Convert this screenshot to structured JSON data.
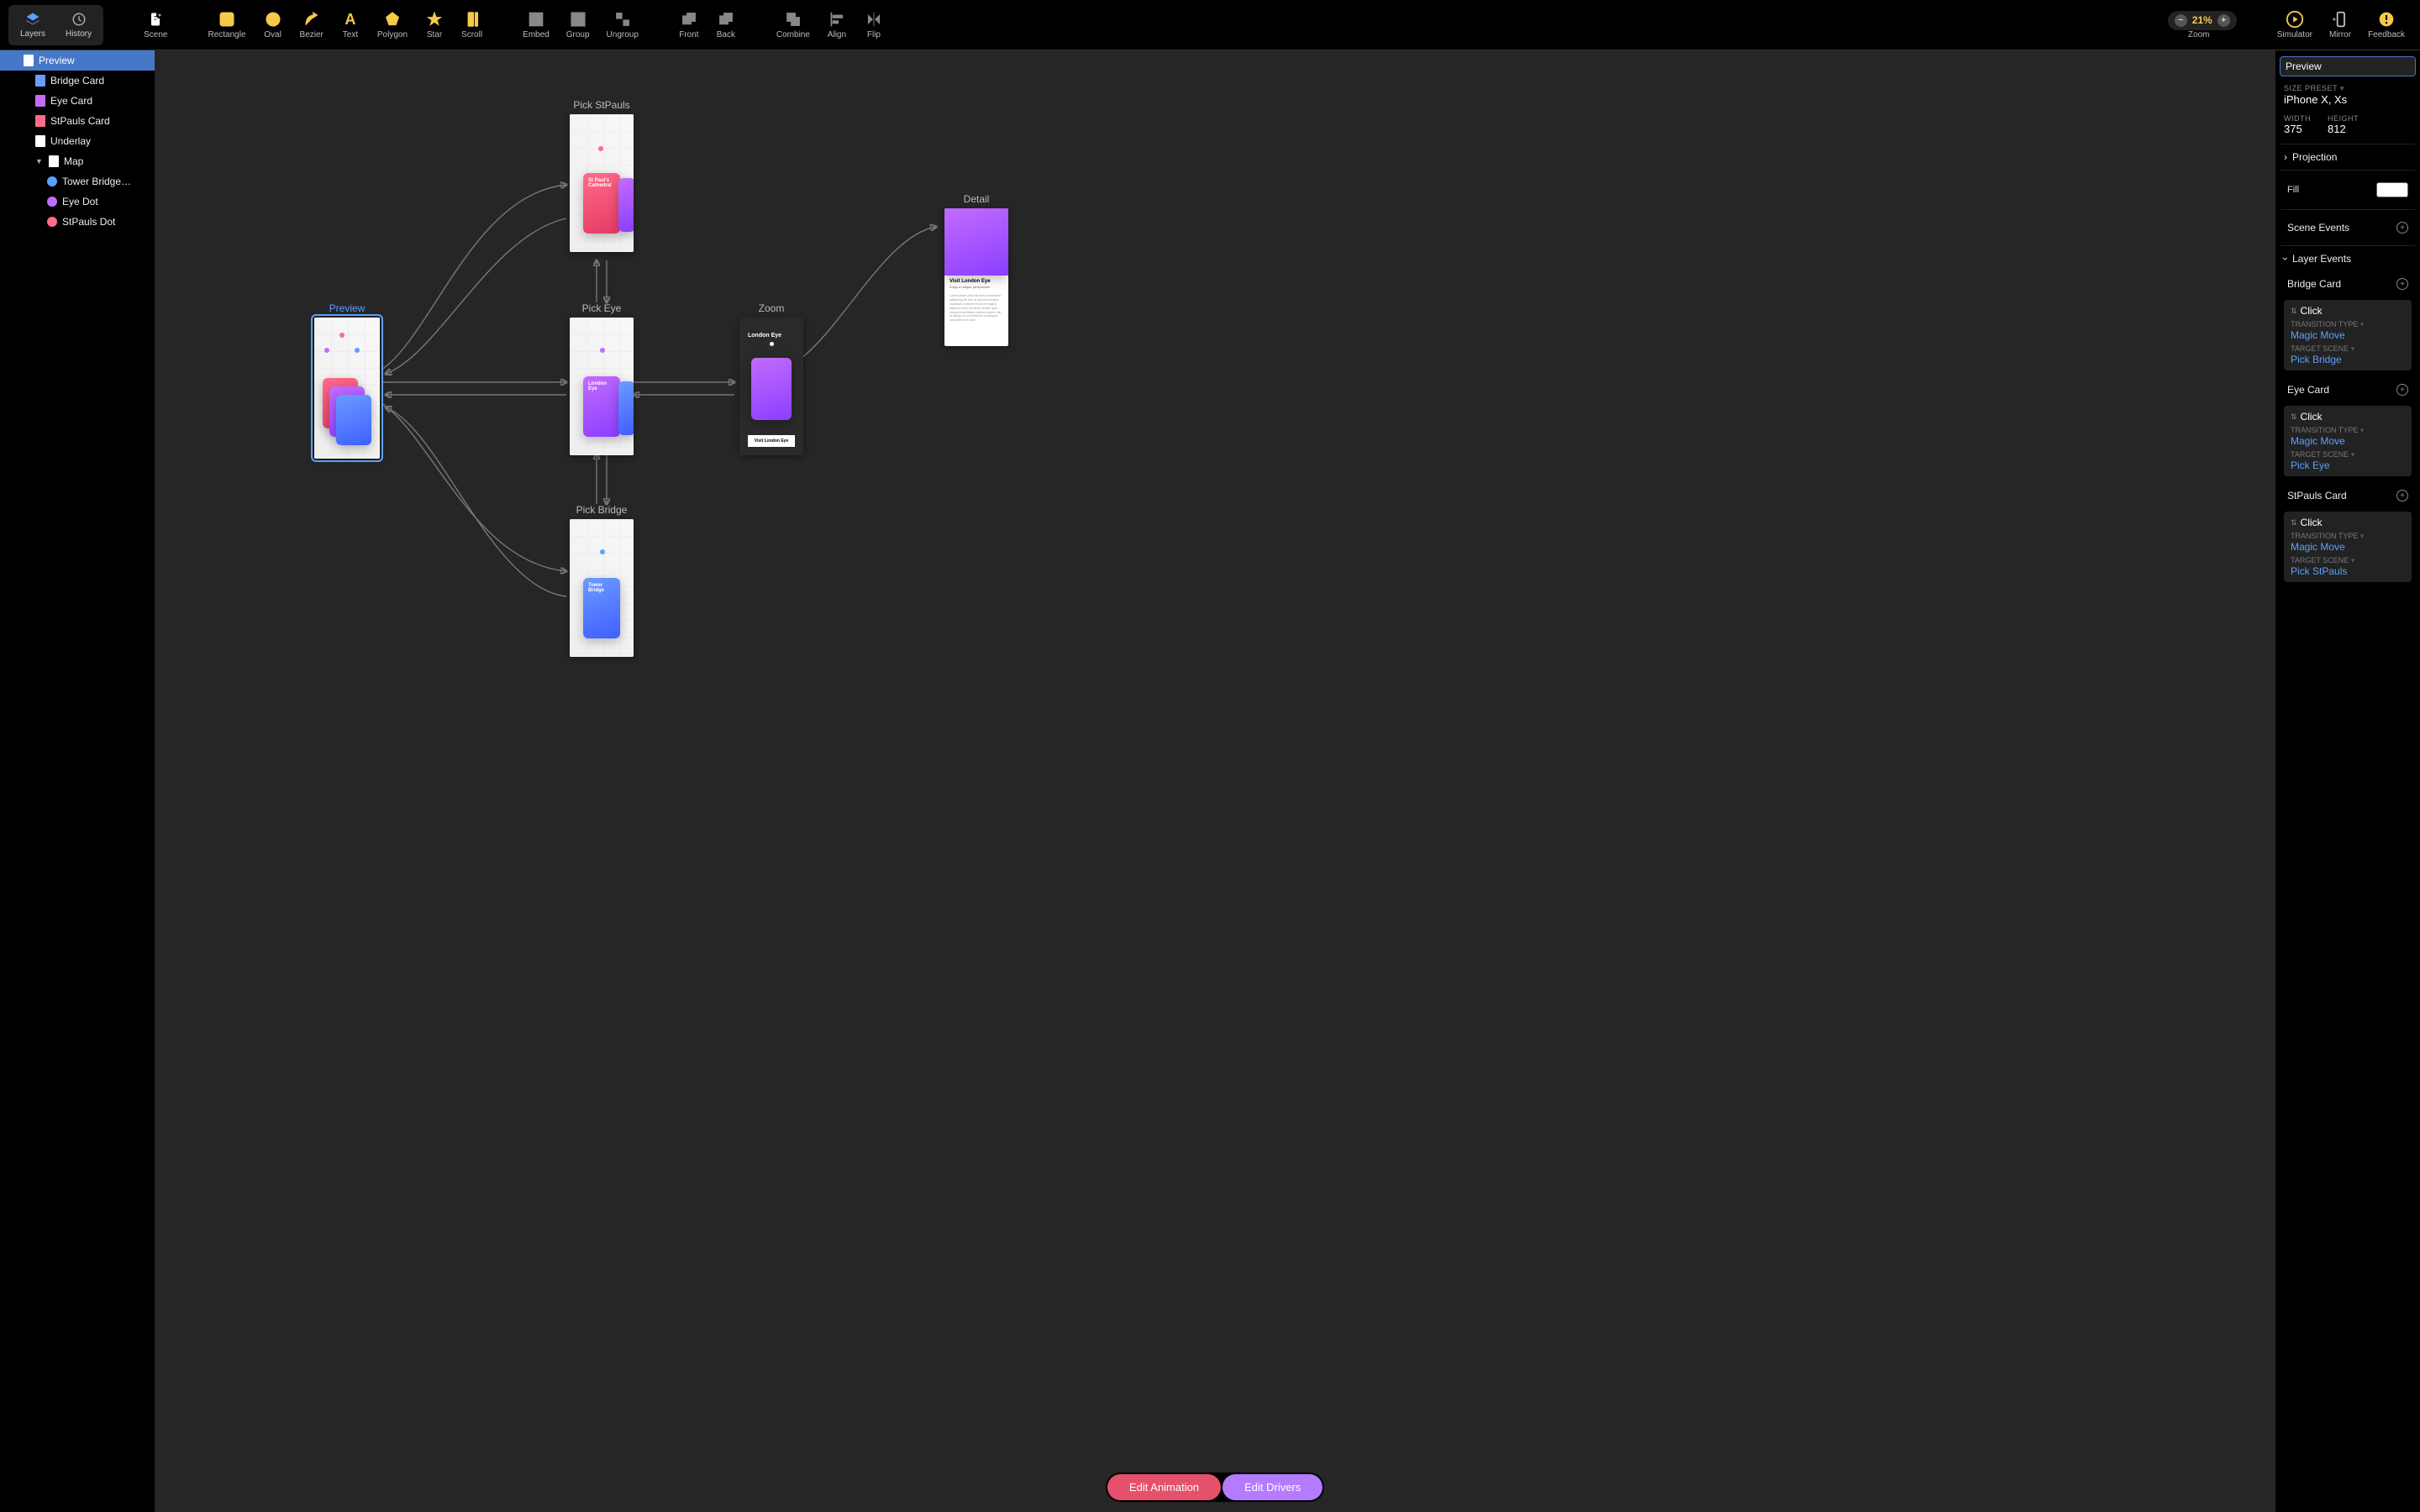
{
  "toolbar": {
    "layers_tab": "Layers",
    "history_tab": "History",
    "scene": "Scene",
    "rectangle": "Rectangle",
    "oval": "Oval",
    "bezier": "Bezier",
    "text": "Text",
    "polygon": "Polygon",
    "star": "Star",
    "scroll": "Scroll",
    "embed": "Embed",
    "group": "Group",
    "ungroup": "Ungroup",
    "front": "Front",
    "back": "Back",
    "combine": "Combine",
    "align": "Align",
    "flip": "Flip",
    "zoom_minus": "−",
    "zoom_value": "21%",
    "zoom_plus": "+",
    "zoom_label": "Zoom",
    "simulator": "Simulator",
    "mirror": "Mirror",
    "feedback": "Feedback"
  },
  "layers": [
    {
      "name": "Preview",
      "indent": 1,
      "selected": true,
      "icon": "rect",
      "color": "#ffffff"
    },
    {
      "name": "Bridge Card",
      "indent": 2,
      "icon": "rect",
      "color": "#6b9bff"
    },
    {
      "name": "Eye Card",
      "indent": 2,
      "icon": "rect",
      "color": "#c36bff"
    },
    {
      "name": "StPauls Card",
      "indent": 2,
      "icon": "rect",
      "color": "#ff6b8a"
    },
    {
      "name": "Underlay",
      "indent": 2,
      "icon": "rect",
      "color": "#ffffff"
    },
    {
      "name": "Map",
      "indent": 2,
      "icon": "rect",
      "color": "#ffffff",
      "caret": "▼"
    },
    {
      "name": "Tower Bridge…",
      "indent": 3,
      "icon": "dot",
      "color": "#5aa0ff"
    },
    {
      "name": "Eye Dot",
      "indent": 3,
      "icon": "dot",
      "color": "#c36bff"
    },
    {
      "name": "StPauls Dot",
      "indent": 3,
      "icon": "dot",
      "color": "#ff6b8a"
    }
  ],
  "canvas": {
    "preview_label": "Preview",
    "pick_stpauls": "Pick StPauls",
    "pick_eye": "Pick Eye",
    "pick_bridge": "Pick Bridge",
    "zoom_label": "Zoom",
    "detail_label": "Detail",
    "footer_anim": "Edit Animation",
    "footer_drivers": "Edit Drivers",
    "card_stpauls": "St Paul's Cathedral",
    "card_eye": "London Eye",
    "card_bridge": "Tower Bridge",
    "zoom_title": "London Eye",
    "detail_title": "Visit London Eye",
    "detail_sub": "Enjoy a unique perspective"
  },
  "inspector": {
    "title_value": "Preview",
    "size_preset_label": "SIZE PRESET",
    "size_preset_value": "iPhone X, Xs",
    "width_label": "WIDTH",
    "width_value": "375",
    "height_label": "HEIGHT",
    "height_value": "812",
    "projection": "Projection",
    "fill": "Fill",
    "scene_events": "Scene Events",
    "layer_events": "Layer Events",
    "events": [
      {
        "layer": "Bridge Card",
        "trigger": "Click",
        "transition_label": "TRANSITION TYPE",
        "transition": "Magic Move",
        "target_label": "TARGET SCENE",
        "target": "Pick Bridge"
      },
      {
        "layer": "Eye Card",
        "trigger": "Click",
        "transition_label": "TRANSITION TYPE",
        "transition": "Magic Move",
        "target_label": "TARGET SCENE",
        "target": "Pick Eye"
      },
      {
        "layer": "StPauls Card",
        "trigger": "Click",
        "transition_label": "TRANSITION TYPE",
        "transition": "Magic Move",
        "target_label": "TARGET SCENE",
        "target": "Pick StPauls"
      }
    ]
  }
}
